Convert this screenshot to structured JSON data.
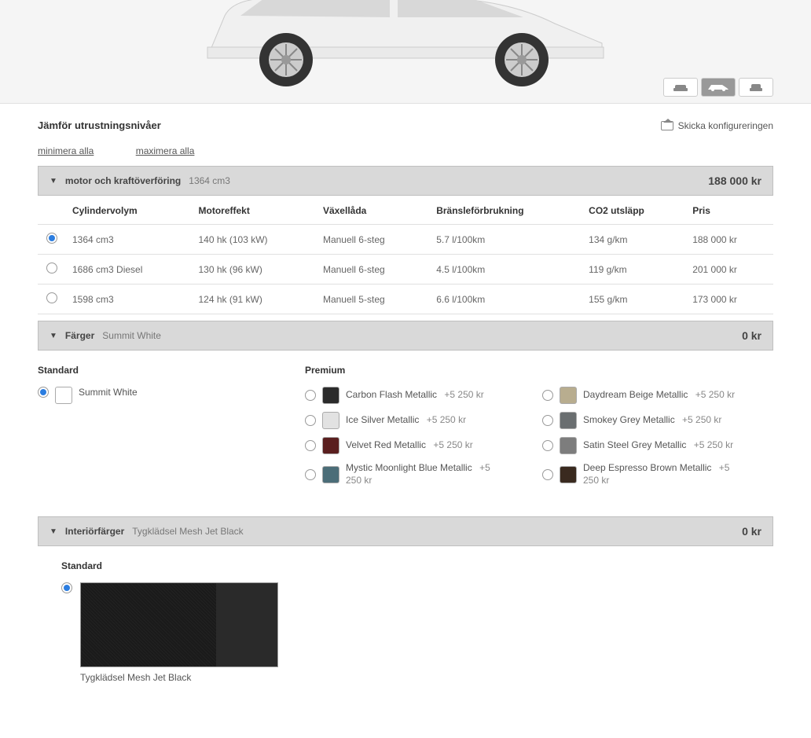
{
  "heading": "Jämför utrustningsnivåer",
  "send_config": "Skicka konfigureringen",
  "links": {
    "minimize": "minimera alla",
    "maximize": "maximera alla"
  },
  "engine": {
    "title": "motor och kraftöverföring",
    "subtitle": "1364 cm3",
    "price": "188 000 kr",
    "headers": {
      "cyl": "Cylindervolym",
      "power": "Motoreffekt",
      "gear": "Växellåda",
      "fuel": "Bränsleförbrukning",
      "co2": "CO2 utsläpp",
      "pris": "Pris"
    },
    "rows": [
      {
        "cyl": "1364 cm3",
        "power": "140 hk (103 kW)",
        "gear": "Manuell 6-steg",
        "fuel": "5.7 l/100km",
        "co2": "134 g/km",
        "pris": "188 000 kr",
        "selected": true
      },
      {
        "cyl": "1686 cm3 Diesel",
        "power": "130 hk (96 kW)",
        "gear": "Manuell 6-steg",
        "fuel": "4.5 l/100km",
        "co2": "119 g/km",
        "pris": "201 000 kr",
        "selected": false
      },
      {
        "cyl": "1598 cm3",
        "power": "124 hk (91 kW)",
        "gear": "Manuell 5-steg",
        "fuel": "6.6 l/100km",
        "co2": "155 g/km",
        "pris": "173 000 kr",
        "selected": false
      }
    ]
  },
  "colors": {
    "title": "Färger",
    "subtitle": "Summit White",
    "price": "0 kr",
    "standard_label": "Standard",
    "premium_label": "Premium",
    "standard": [
      {
        "name": "Summit White",
        "price": "",
        "hex": "#ffffff",
        "selected": true
      }
    ],
    "premium_left": [
      {
        "name": "Carbon Flash Metallic",
        "price": "+5 250 kr",
        "hex": "#2b2b2b"
      },
      {
        "name": "Ice Silver Metallic",
        "price": "+5 250 kr",
        "hex": "#e2e2e2"
      },
      {
        "name": "Velvet Red Metallic",
        "price": "+5 250 kr",
        "hex": "#5a1f1f"
      },
      {
        "name": "Mystic Moonlight Blue Metallic",
        "price": "+5 250 kr",
        "hex": "#4b6d78"
      }
    ],
    "premium_right": [
      {
        "name": "Daydream Beige Metallic",
        "price": "+5 250 kr",
        "hex": "#b8ad8f"
      },
      {
        "name": "Smokey Grey Metallic",
        "price": "+5 250 kr",
        "hex": "#6a6e70"
      },
      {
        "name": "Satin Steel Grey Metallic",
        "price": "+5 250 kr",
        "hex": "#7d7d7d"
      },
      {
        "name": "Deep Espresso Brown Metallic",
        "price": "+5 250 kr",
        "hex": "#3a2a1f"
      }
    ]
  },
  "interior": {
    "title": "Interiörfärger",
    "subtitle": "Tygklädsel Mesh Jet Black",
    "price": "0 kr",
    "standard_label": "Standard",
    "option": "Tygklädsel Mesh Jet Black"
  }
}
